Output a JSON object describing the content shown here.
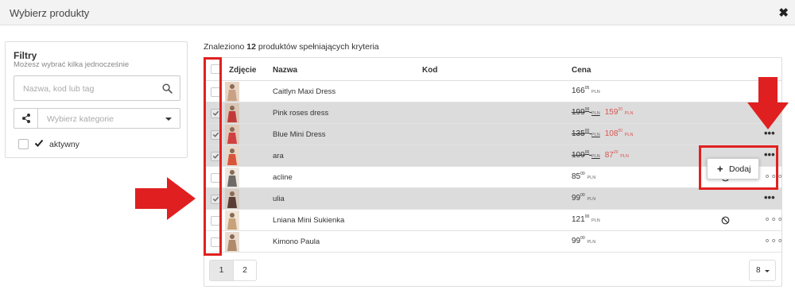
{
  "modal": {
    "title": "Wybierz produkty"
  },
  "filters": {
    "title": "Filtry",
    "subtitle": "Możesz wybrać kilka jednocześnie",
    "search_placeholder": "Nazwa, kod lub tag",
    "category_placeholder": "Wybierz kategorie",
    "active_label": "aktywny"
  },
  "results": {
    "prefix": "Znaleziono ",
    "count": "12",
    "suffix": " produktów spełniających kryteria"
  },
  "table": {
    "headers": {
      "photo": "Zdjęcie",
      "name": "Nazwa",
      "code": "Kod",
      "price": "Cena"
    },
    "rows": [
      {
        "name": "Caitlyn Maxi Dress",
        "selected": false,
        "price_main": "166",
        "price_cents": "05",
        "currency": "PLN"
      },
      {
        "name": "Pink roses dress",
        "selected": true,
        "old_main": "199",
        "old_cents": "00",
        "price_main": "159",
        "price_cents": "20",
        "currency": "PLN"
      },
      {
        "name": "Blue Mini Dress",
        "selected": true,
        "old_main": "135",
        "old_cents": "00",
        "price_main": "108",
        "price_cents": "00",
        "currency": "PLN"
      },
      {
        "name": "ara",
        "selected": true,
        "old_main": "109",
        "old_cents": "00",
        "price_main": "87",
        "price_cents": "20",
        "currency": "PLN"
      },
      {
        "name": "acline",
        "selected": false,
        "price_main": "85",
        "price_cents": "00",
        "currency": "PLN"
      },
      {
        "name": "ulia",
        "selected": true,
        "price_main": "99",
        "price_cents": "00",
        "currency": "PLN"
      },
      {
        "name": "Lniana Mini Sukienka",
        "selected": false,
        "price_main": "121",
        "price_cents": "00",
        "currency": "PLN"
      },
      {
        "name": "Kimono Paula",
        "selected": false,
        "price_main": "99",
        "price_cents": "00",
        "currency": "PLN"
      }
    ]
  },
  "context_menu": {
    "add_label": "Dodaj"
  },
  "pagination": {
    "pages": [
      "1",
      "2"
    ],
    "active": "1",
    "per_page": "8"
  },
  "colors": {
    "highlight": "#e02020",
    "sale_price": "#d9534f",
    "selected_row": "#dcdcdc"
  }
}
